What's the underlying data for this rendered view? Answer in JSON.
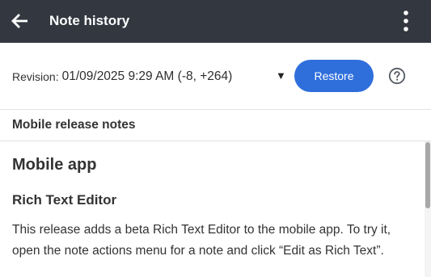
{
  "header": {
    "title": "Note history",
    "back_icon": "arrow-left-icon",
    "menu_icon": "more-vertical-icon"
  },
  "revision": {
    "label": "Revision:",
    "value": "01/09/2025 9:29 AM (-8, +264)",
    "caret": "▼",
    "restore_label": "Restore",
    "help_icon": "help-circle-icon"
  },
  "note": {
    "title": "Mobile release notes",
    "heading1": "Mobile app",
    "heading2": "Rich Text Editor",
    "paragraph_line1": "This release adds a beta Rich Text Editor to the mobile app. To try it,",
    "paragraph_line2": "open the note actions menu for a note and click “Edit as Rich Text”."
  },
  "colors": {
    "header_bg": "#333840",
    "accent": "#2f6fdc"
  }
}
